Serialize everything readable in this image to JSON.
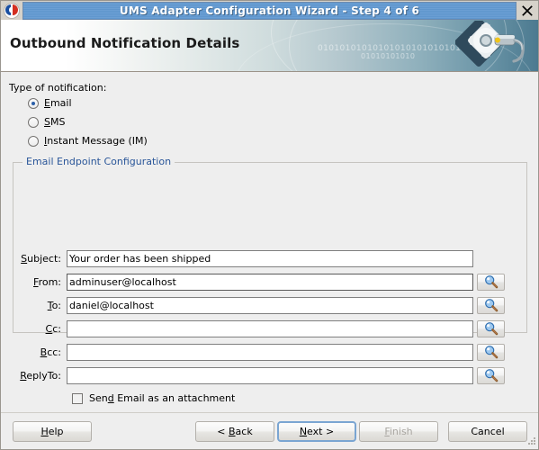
{
  "window": {
    "title": "UMS Adapter Configuration Wizard - Step 4 of 6",
    "app_icon": "oracle-logo-icon",
    "close_icon": "close-icon",
    "resize_grip_icon": "resize-grip-icon"
  },
  "banner": {
    "heading": "Outbound Notification Details",
    "binary_line_1": "0101010101010101010101010101",
    "binary_line_2": "01010101010",
    "gear_icon": "gear-wrench-icon"
  },
  "notification": {
    "type_label": "Type of notification:",
    "options": [
      {
        "label": "Email",
        "mnemonic": "E",
        "selected": true
      },
      {
        "label": "SMS",
        "mnemonic": "S",
        "selected": false
      },
      {
        "label": "Instant Message (IM)",
        "mnemonic": "I",
        "selected": false
      }
    ]
  },
  "email_group": {
    "title": "Email Endpoint Configuration",
    "browse_icon": "search-magnifier-icon",
    "fields": [
      {
        "label": "Subject:",
        "mnemonic": "S",
        "value": "Your order has been shipped",
        "has_browse": false,
        "focused": false
      },
      {
        "label": "From:",
        "mnemonic": "F",
        "value": "adminuser@localhost",
        "has_browse": true,
        "focused": true
      },
      {
        "label": "To:",
        "mnemonic": "T",
        "value": "daniel@localhost",
        "has_browse": true,
        "focused": false
      },
      {
        "label": "Cc:",
        "mnemonic": "C",
        "value": "",
        "has_browse": true,
        "focused": false
      },
      {
        "label": "Bcc:",
        "mnemonic": "B",
        "value": "",
        "has_browse": true,
        "focused": false
      },
      {
        "label": "ReplyTo:",
        "mnemonic": "R",
        "value": "",
        "has_browse": true,
        "focused": false
      }
    ],
    "attachment_checkbox": {
      "label": "Send Email as an attachment",
      "mnemonic": "d",
      "checked": false
    }
  },
  "buttons": {
    "help": "Help",
    "back": "< Back",
    "next": "Next >",
    "finish": "Finish",
    "cancel": "Cancel"
  },
  "colors": {
    "titlebar_blue": "#5f96cd",
    "group_title_blue": "#2a5699",
    "banner_teal": "#4c7a90",
    "focus_border": "#7aa5d2",
    "disabled_text": "#a9a6a1"
  }
}
